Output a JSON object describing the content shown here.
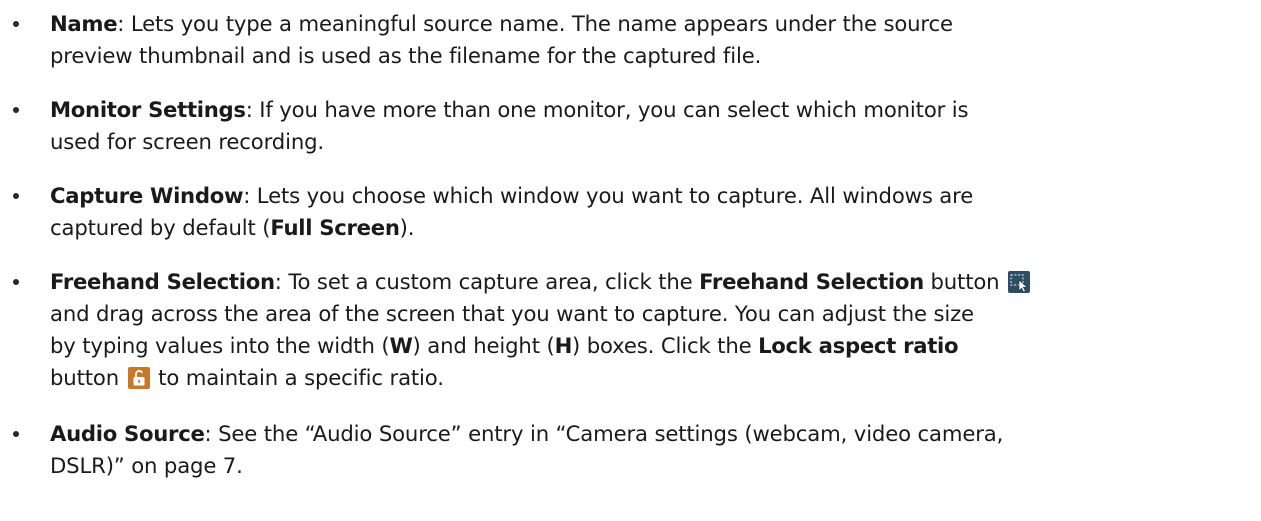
{
  "items": [
    {
      "term": "Name",
      "lines": [
        ": Lets you type a meaningful source name. The name appears under the source",
        "preview thumbnail and is used as the filename for the captured file."
      ]
    },
    {
      "term": "Monitor Settings",
      "lines": [
        ": If you have more than one monitor, you can select which monitor is",
        "used for screen recording."
      ]
    },
    {
      "term": "Capture Window",
      "line1": ": Lets you choose which window you want to capture. All windows are",
      "line2_pre": "captured by default (",
      "line2_bold": "Full Screen",
      "line2_post": ")."
    },
    {
      "term": "Freehand Selection",
      "line1_a": ": To set a custom capture area, click the ",
      "line1_bold": "Freehand Selection",
      "line1_b": " button",
      "line2": "and drag across the area of the screen that you want to capture. You can adjust the size",
      "line3_a": "by typing values into the width (",
      "line3_w": "W",
      "line3_b": ") and height (",
      "line3_h": "H",
      "line3_c": ") boxes. Click the ",
      "line3_bold": "Lock aspect ratio",
      "line4_a": "button",
      "line4_b": " to maintain a specific ratio.",
      "icons": [
        "freehand-selection-icon",
        "lock-aspect-ratio-icon"
      ]
    },
    {
      "term": "Audio Source",
      "lines": [
        ": See the “Audio Source” entry in “Camera settings (webcam, video camera,",
        "DSLR)” on page 7."
      ]
    }
  ],
  "colors": {
    "text": "#1a1a1a",
    "freehand_icon_bg": "#2f4e63",
    "lock_icon_bg": "#c8782a"
  }
}
